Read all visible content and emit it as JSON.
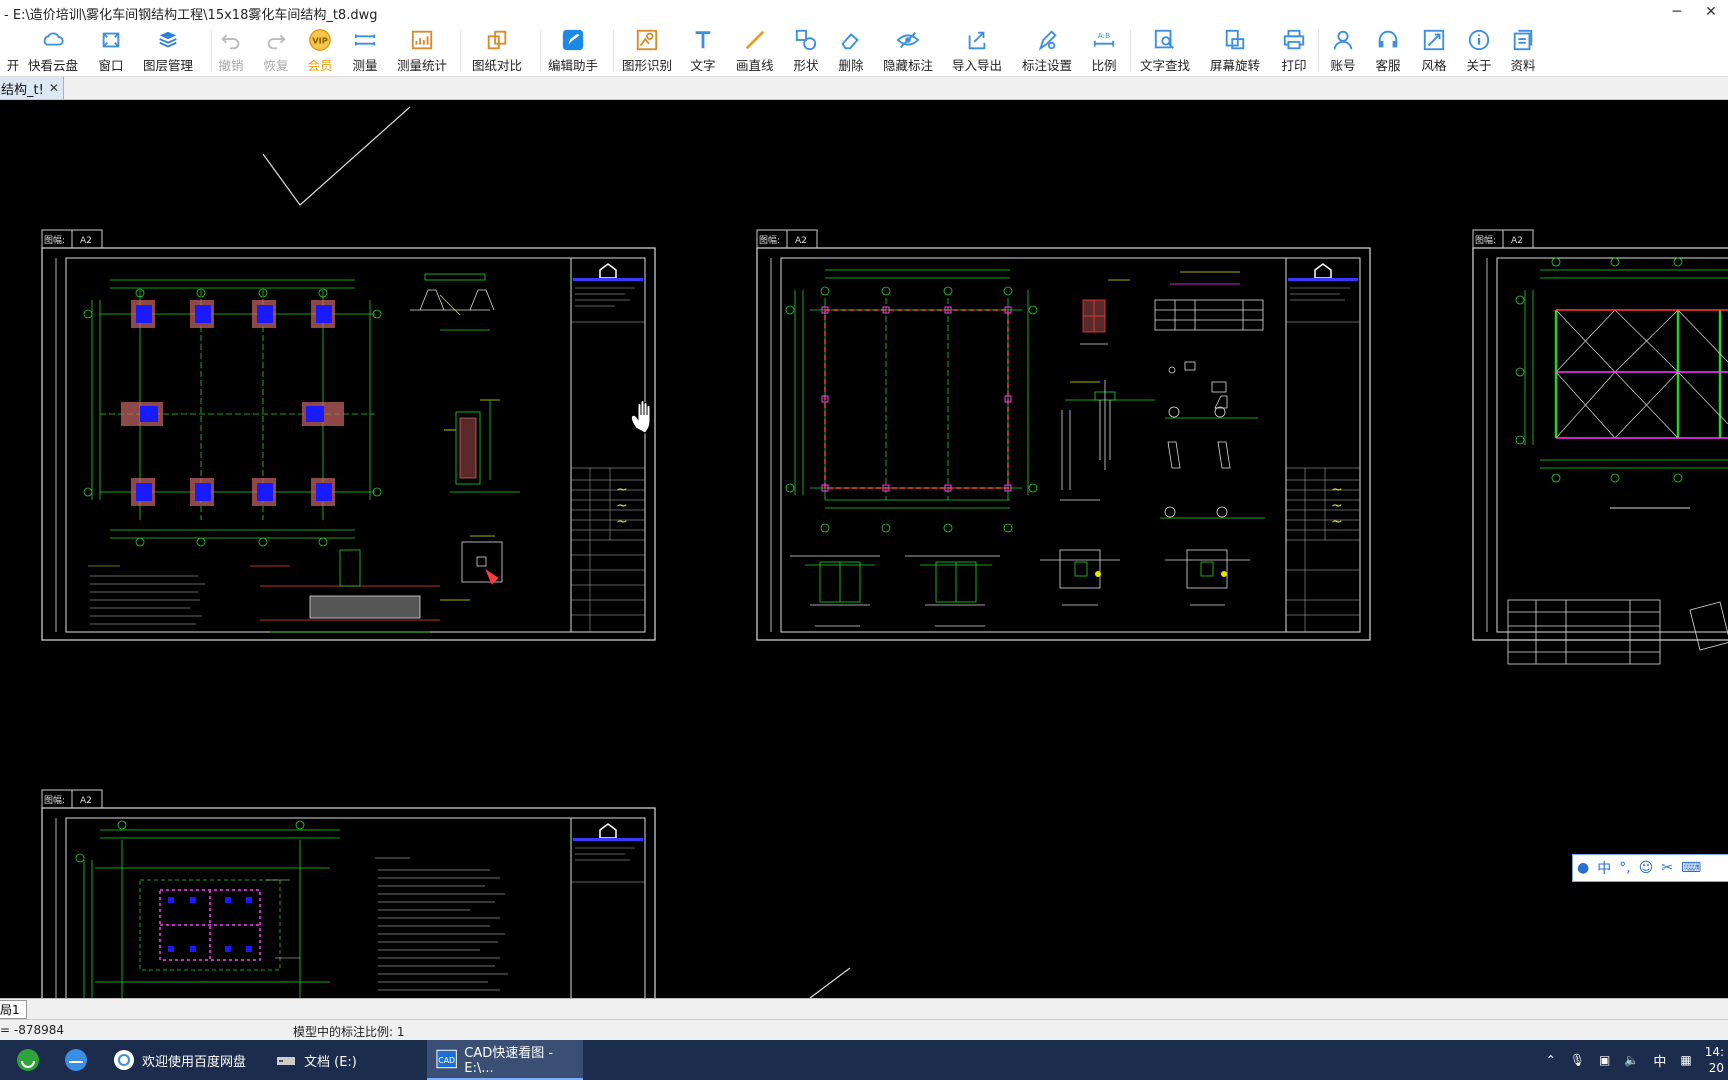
{
  "window": {
    "title": "- E:\\造价培训\\雾化车间钢结构工程\\15x18雾化车间结构_t8.dwg",
    "minimize": "─",
    "close": "✕"
  },
  "toolbar": {
    "items": [
      {
        "label": "开",
        "icon": "open-icon"
      },
      {
        "label": "快看云盘",
        "icon": "cloud-icon"
      },
      {
        "label": "窗口",
        "icon": "window-icon"
      },
      {
        "label": "图层管理",
        "icon": "layers-icon"
      },
      {
        "label": "撤销",
        "icon": "undo-icon"
      },
      {
        "label": "恢复",
        "icon": "redo-icon"
      },
      {
        "label": "会员",
        "icon": "vip-icon"
      },
      {
        "label": "测量",
        "icon": "measure-icon"
      },
      {
        "label": "测量统计",
        "icon": "measure-stats-icon"
      },
      {
        "label": "图纸对比",
        "icon": "compare-icon"
      },
      {
        "label": "编辑助手",
        "icon": "edit-assistant-icon"
      },
      {
        "label": "图形识别",
        "icon": "shape-recognition-icon"
      },
      {
        "label": "文字",
        "icon": "text-icon"
      },
      {
        "label": "画直线",
        "icon": "line-icon"
      },
      {
        "label": "形状",
        "icon": "shapes-icon"
      },
      {
        "label": "删除",
        "icon": "eraser-icon"
      },
      {
        "label": "隐藏标注",
        "icon": "hide-annotation-icon"
      },
      {
        "label": "导入导出",
        "icon": "import-export-icon"
      },
      {
        "label": "标注设置",
        "icon": "annotation-settings-icon"
      },
      {
        "label": "比例",
        "icon": "scale-icon"
      },
      {
        "label": "文字查找",
        "icon": "text-search-icon"
      },
      {
        "label": "屏幕旋转",
        "icon": "rotate-screen-icon"
      },
      {
        "label": "打印",
        "icon": "print-icon"
      },
      {
        "label": "账号",
        "icon": "account-icon"
      },
      {
        "label": "客服",
        "icon": "headset-icon"
      },
      {
        "label": "风格",
        "icon": "style-icon"
      },
      {
        "label": "关于",
        "icon": "info-icon"
      },
      {
        "label": "资料",
        "icon": "docs-icon"
      }
    ]
  },
  "tab": {
    "label": "结构_t!",
    "close": "✕"
  },
  "drawing": {
    "sheet_code": "图幅:",
    "sheet_size": "A2"
  },
  "ime": {
    "lang": "中",
    "symbols": "°,"
  },
  "layout_tab": "局1",
  "status": {
    "coords": "= -878984",
    "scale_text": "模型中的标注比例: 1"
  },
  "taskbar": {
    "items": [
      {
        "label": "欢迎使用百度网盘"
      },
      {
        "label": "文档 (E:)"
      },
      {
        "label": "CAD快速看图 - E:\\..."
      }
    ],
    "tray": {
      "lang": "中",
      "time": "14:",
      "date": "20"
    }
  },
  "colors": {
    "canvas_bg": "#000000",
    "frame": "#ffffff",
    "cad_green": "#22d322",
    "cad_yellow": "#e6e600",
    "cad_red": "#ff3b3b",
    "cad_blue": "#1a1aff",
    "cad_magenta": "#ff3bff",
    "cad_cyan": "#22d3d3"
  }
}
